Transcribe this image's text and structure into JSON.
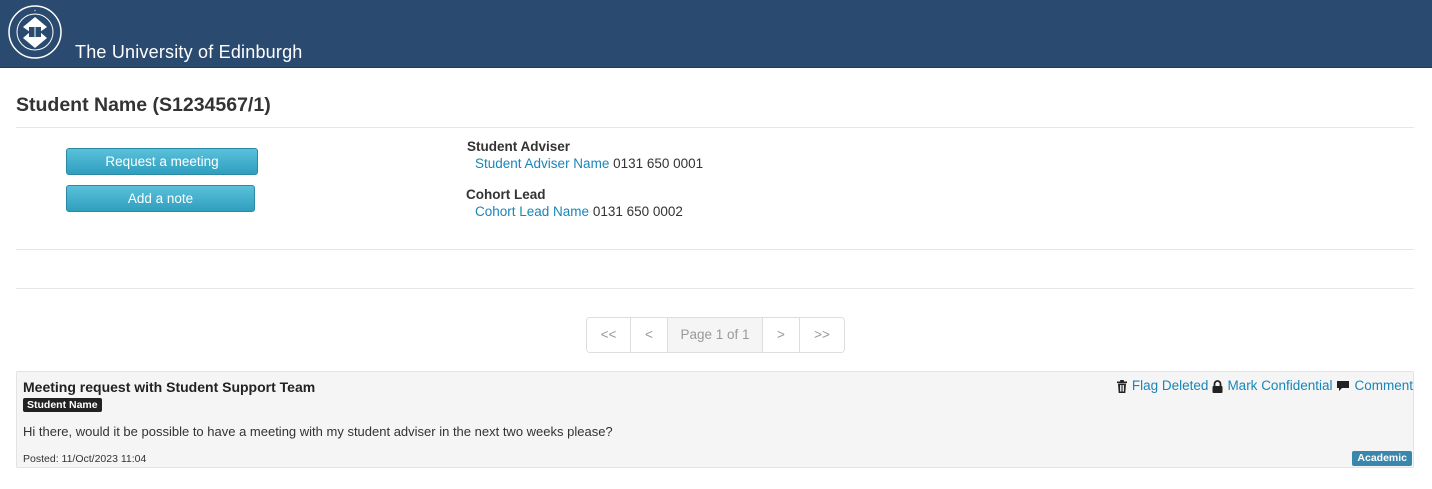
{
  "header": {
    "university_name": "The University of Edinburgh"
  },
  "page": {
    "title": "Student Name (S1234567/1)"
  },
  "buttons": {
    "request_meeting": "Request a meeting",
    "add_note": "Add a note"
  },
  "contacts": [
    {
      "role": "Student Adviser",
      "name": "Student Adviser Name",
      "phone": "0131 650 0001"
    },
    {
      "role": "Cohort Lead",
      "name": "Cohort Lead Name",
      "phone": "0131 650 0002"
    }
  ],
  "pagination": {
    "first": "<<",
    "prev": "<",
    "info": "Page 1 of 1",
    "next": ">",
    "last": ">>"
  },
  "notes": [
    {
      "title": "Meeting request with Student Support Team",
      "author": "Student Name",
      "body": "Hi there, would it be possible to have a meeting with my student adviser in the next two weeks please?",
      "posted": "Posted: 11/Oct/2023 11:04",
      "category": "Academic",
      "actions": {
        "flag_deleted": "Flag Deleted",
        "mark_confidential": "Mark Confidential",
        "comment": "Comment"
      }
    }
  ],
  "colors": {
    "header_bg": "#2b4a70",
    "button": "#3badcc",
    "link": "#1a85b8",
    "category_badge": "#3a87ad",
    "author_badge": "#222222"
  }
}
